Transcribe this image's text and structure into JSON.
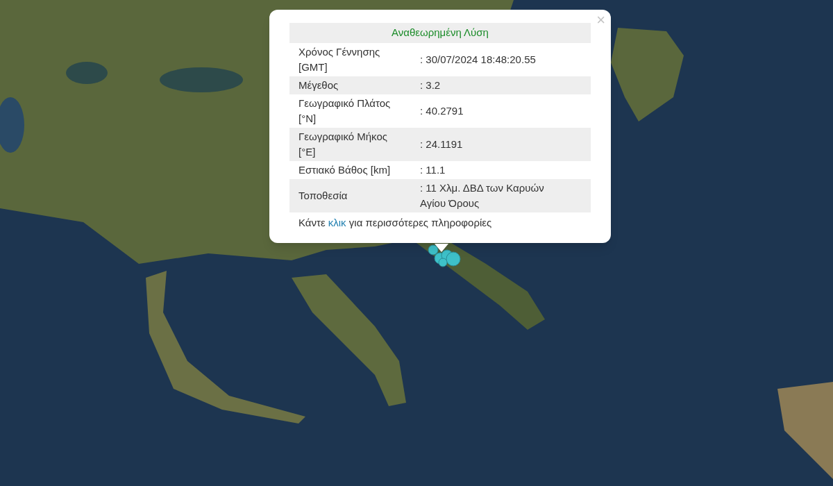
{
  "popup": {
    "title": "Αναθεωρημένη Λύση",
    "close": "×",
    "rows": [
      {
        "label": "Χρόνος Γέννησης [GMT]",
        "value": ": 30/07/2024 18:48:20.55"
      },
      {
        "label": "Μέγεθος",
        "value": ": 3.2"
      },
      {
        "label": "Γεωγραφικό Πλάτος [°N]",
        "value": ": 40.2791"
      },
      {
        "label": "Γεωγραφικό Μήκος [°E]",
        "value": ": 24.1191"
      },
      {
        "label": "Εστιακό Βάθος [km]",
        "value": ": 11.1"
      },
      {
        "label": "Τοποθεσία",
        "value": ": 11 Χλμ. ΔΒΔ των Καρυών Αγίου Όρους"
      }
    ],
    "footer": {
      "before": "Κάντε",
      "link": "κλικ",
      "after": "για περισσότερες πληροφορίες"
    }
  }
}
